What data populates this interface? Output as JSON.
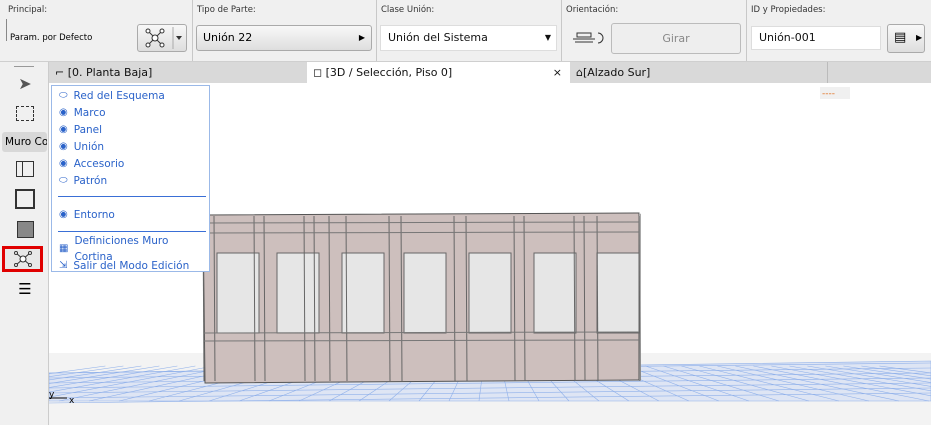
{
  "infobox": {
    "principal": {
      "label": "Principal:",
      "value": "Param. por Defecto"
    },
    "tipo_parte": {
      "label": "Tipo de Parte:",
      "value": "Unión 22"
    },
    "clase_union": {
      "label": "Clase Unión:",
      "value": "Unión del Sistema"
    },
    "orientacion": {
      "label": "Orientación:",
      "button": "Girar"
    },
    "id": {
      "label": "ID y Propiedades:",
      "value": "Unión-001"
    }
  },
  "tabs": [
    {
      "label": "[0. Planta Baja]"
    },
    {
      "label": "[3D / Selección, Piso 0]",
      "close": "×"
    },
    {
      "label": "[Alzado Sur]"
    }
  ],
  "toolbox": {
    "group_label": "Muro Co"
  },
  "menu": {
    "items": [
      {
        "label": "Red del Esquema",
        "icon": "eye-closed"
      },
      {
        "label": "Marco",
        "icon": "eye"
      },
      {
        "label": "Panel",
        "icon": "eye"
      },
      {
        "label": "Unión",
        "icon": "eye"
      },
      {
        "label": "Accesorio",
        "icon": "eye"
      },
      {
        "label": "Patrón",
        "icon": "eye-closed"
      },
      {
        "label": "Entorno",
        "icon": "eye"
      },
      {
        "label": "Definiciones Muro Cortina",
        "icon": "grid"
      },
      {
        "label": "Salir del Modo Edición",
        "icon": "exit"
      }
    ]
  },
  "view": {
    "axis_y": "y",
    "axis_x": "x",
    "scale_marker": "----"
  },
  "colors": {
    "menu_text": "#2a62c9",
    "highlight": "#e00000",
    "grid": "#7fa6e8"
  }
}
